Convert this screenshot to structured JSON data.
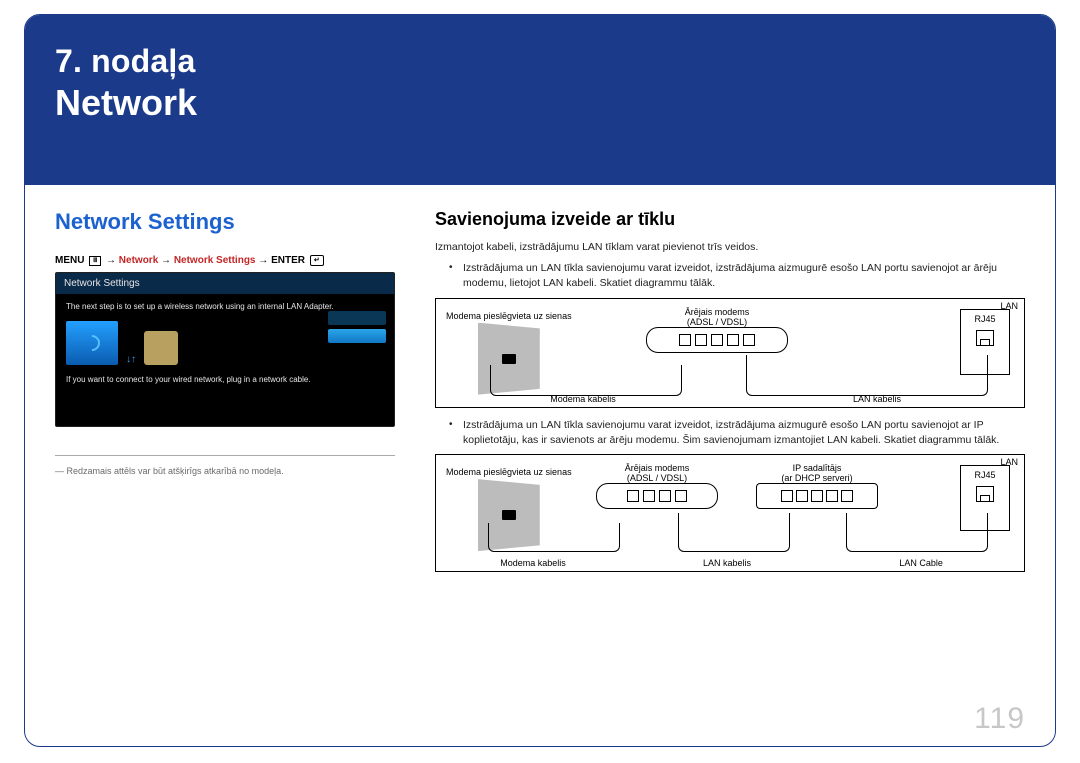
{
  "header": {
    "chapter": "7. nodaļa",
    "title": "Network"
  },
  "left": {
    "heading": "Network Settings",
    "breadcrumb": {
      "menu": "MENU",
      "arrow": "→",
      "p1": "Network",
      "p2": "Network Settings",
      "enter": "ENTER"
    },
    "screenshot": {
      "title": "Network Settings",
      "line1": "The next step is to set up a wireless network using an internal LAN Adapter.",
      "line2": "If you want to connect to your wired network, plug in a network cable."
    },
    "disclaimer": "― Redzamais attēls var būt atšķirīgs atkarībā no modeļa."
  },
  "right": {
    "heading": "Savienojuma izveide ar tīklu",
    "intro": "Izmantojot kabeli, izstrādājumu LAN tīklam varat pievienot trīs veidos.",
    "bullet1": "Izstrādājuma un LAN tīkla savienojumu varat izveidot, izstrādājuma aizmugurē esošo LAN portu savienojot ar ārēju modemu, lietojot LAN kabeli. Skatiet diagrammu tālāk.",
    "bullet2": "Izstrādājuma un LAN tīkla savienojumu varat izveidot, izstrādājuma aizmugurē esošo LAN portu savienojot ar IP koplietotāju, kas ir savienots ar ārēju modemu. Šim savienojumam izmantojiet LAN kabeli. Skatiet diagrammu tālāk.",
    "diagram1": {
      "wall": "Modema pieslēgvieta uz sienas",
      "modem": "Ārējais modems\n(ADSL / VDSL)",
      "lan": "LAN",
      "rj45": "RJ45",
      "modemCable": "Modema kabelis",
      "lanCable": "LAN kabelis"
    },
    "diagram2": {
      "wall": "Modema pieslēgvieta uz sienas",
      "modem": "Ārējais modems\n(ADSL / VDSL)",
      "iphub": "IP sadalītājs\n(ar DHCP serveri)",
      "lan": "LAN",
      "rj45": "RJ45",
      "modemCable": "Modema kabelis",
      "lanCable": "LAN kabelis",
      "lanCable2": "LAN Cable"
    }
  },
  "page": "119"
}
